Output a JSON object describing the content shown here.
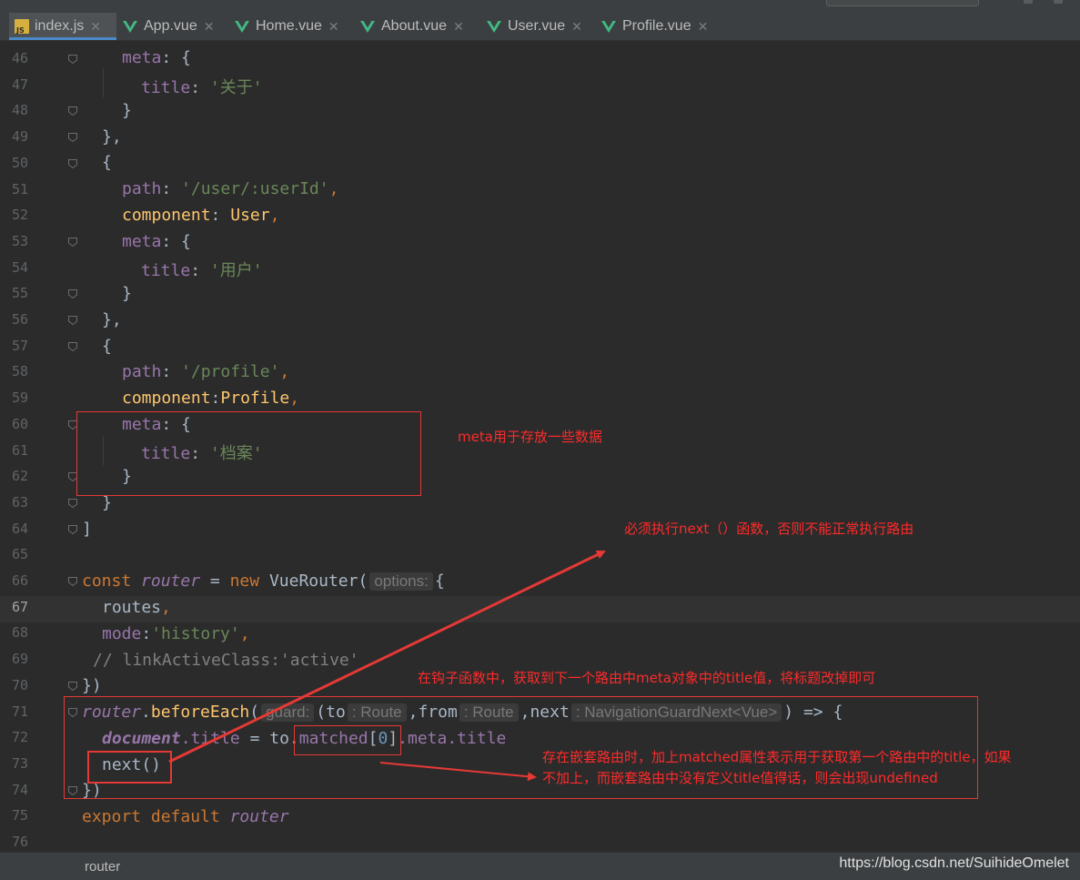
{
  "colors": {
    "background": "#2b2b2b",
    "keyword": "#cc7832",
    "property": "#9876aa",
    "string": "#6a8759",
    "function": "#ffc66d",
    "annotation": "#ff2a2a"
  },
  "tabs": [
    {
      "label": "index.js",
      "icon": "js-file-icon",
      "close": "✕"
    },
    {
      "label": "App.vue",
      "icon": "vue-file-icon",
      "close": "✕"
    },
    {
      "label": "Home.vue",
      "icon": "vue-file-icon",
      "close": "✕"
    },
    {
      "label": "About.vue",
      "icon": "vue-file-icon",
      "close": "✕"
    },
    {
      "label": "User.vue",
      "icon": "vue-file-icon",
      "close": "✕"
    },
    {
      "label": "Profile.vue",
      "icon": "vue-file-icon",
      "close": "✕"
    }
  ],
  "editor": {
    "line_numbers": [
      "46",
      "47",
      "48",
      "49",
      "50",
      "51",
      "52",
      "53",
      "54",
      "55",
      "56",
      "57",
      "58",
      "59",
      "60",
      "61",
      "62",
      "63",
      "64",
      "65",
      "66",
      "67",
      "68",
      "69",
      "70",
      "71",
      "72",
      "73",
      "74",
      "75",
      "76"
    ],
    "current_line": "67",
    "code": {
      "l46_key": "meta",
      "l46_rest": ": {",
      "l47_key": "title",
      "l47_colon": ": ",
      "l47_val": "'关于'",
      "l48": "}",
      "l49": "},",
      "l50": "{",
      "l51_key": "path",
      "l51_colon": ": ",
      "l51_val": "'/user/:userId'",
      "l51_end": ",",
      "l52_key": "component",
      "l52_colon": ": ",
      "l52_val": "User",
      "l52_end": ",",
      "l53_key": "meta",
      "l53_rest": ": {",
      "l54_key": "title",
      "l54_colon": ": ",
      "l54_val": "'用户'",
      "l55": "}",
      "l56": "},",
      "l57": "{",
      "l58_key": "path",
      "l58_colon": ": ",
      "l58_val": "'/profile'",
      "l58_end": ",",
      "l59_key": "component",
      "l59_colon": ":",
      "l59_val": "Profile",
      "l59_end": ",",
      "l60_key": "meta",
      "l60_rest": ": {",
      "l61_key": "title",
      "l61_colon": ": ",
      "l61_val": "'档案'",
      "l62": "}",
      "l63": "}",
      "l64": "]",
      "l66_const": "const",
      "l66_name": "router",
      "l66_eq": " = ",
      "l66_new": "new",
      "l66_cls": "VueRouter(",
      "l66_hint": "options:",
      "l66_end": "{",
      "l67_routes": "routes",
      "l67_end": ",",
      "l68_mode": "mode",
      "l68_colon": ":",
      "l68_val": "'history'",
      "l68_end": ",",
      "l69_comment": "// linkActiveClass:'active'",
      "l70": "})",
      "l71_router": "router",
      "l71_dot": ".",
      "l71_fn": "beforeEach",
      "l71_paren": "(",
      "l71_hint_guard": "guard:",
      "l71_to": "(to",
      "l71_hint_route1": ": Route",
      "l71_from": ",from",
      "l71_hint_route2": ": Route",
      "l71_next": ",next",
      "l71_hint_nav": ": NavigationGuardNext<Vue>",
      "l71_end": ") => {",
      "l72_doc": "document",
      "l72_title": ".title",
      "l72_eq": " = to.",
      "l72_matched": "matched",
      "l72_b1": "[",
      "l72_zero": "0",
      "l72_b2": "]",
      "l72_meta": ".meta",
      "l72_t": ".title",
      "l73": "next()",
      "l74": "})",
      "l75_export": "export default",
      "l75_router": "router"
    }
  },
  "annotations": {
    "meta_note": "meta用于存放一些数据",
    "next_note": "必须执行next（）函数，否则不能正常执行路由",
    "hook_note": "在钩子函数中，获取到下一个路由中meta对象中的title值，将标题改掉即可",
    "matched_note": "存在嵌套路由时，加上matched属性表示用于获取第一个路由中的title，如果\n不加上，而嵌套路由中没有定义title值得话，则会出现undefined"
  },
  "statusbar": {
    "breadcrumb": "router",
    "watermark": "https://blog.csdn.net/SuihideOmelet"
  }
}
